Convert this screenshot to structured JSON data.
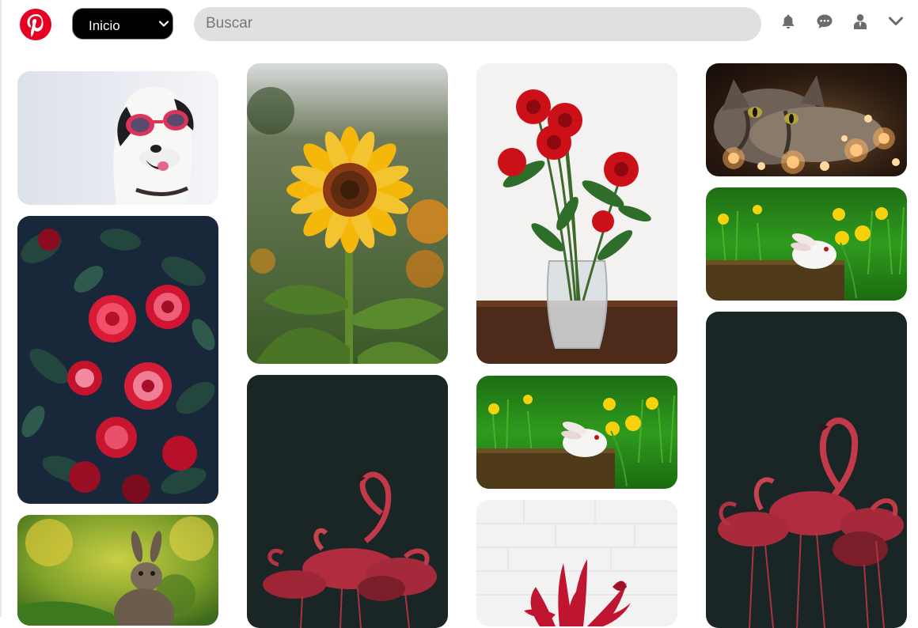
{
  "header": {
    "logo_icon": "pinterest-logo",
    "home_select": {
      "selected": "Inicio",
      "icon": "chevron-down-icon"
    },
    "search": {
      "placeholder": "Buscar",
      "value": ""
    },
    "icons": [
      "bell-icon",
      "chat-bubble-icon",
      "user-icon",
      "chevron-down-icon"
    ]
  },
  "colors": {
    "brand": "#e60023",
    "select_bg": "#000000",
    "search_bg": "#e0e0e0"
  },
  "pins": [
    {
      "subject": "dog-with-sunglasses",
      "column": 1
    },
    {
      "subject": "red-roses-bush",
      "column": 1
    },
    {
      "subject": "wild-rabbit",
      "column": 1
    },
    {
      "subject": "sunflower",
      "column": 2
    },
    {
      "subject": "flamingos",
      "column": 2
    },
    {
      "subject": "roses-in-vase",
      "column": 3
    },
    {
      "subject": "white-bunny-dandelions",
      "column": 3
    },
    {
      "subject": "red-lilies",
      "column": 3
    },
    {
      "subject": "cat-with-lights",
      "column": 4
    },
    {
      "subject": "white-bunny-dandelions",
      "column": 4
    },
    {
      "subject": "flamingos",
      "column": 4
    }
  ]
}
